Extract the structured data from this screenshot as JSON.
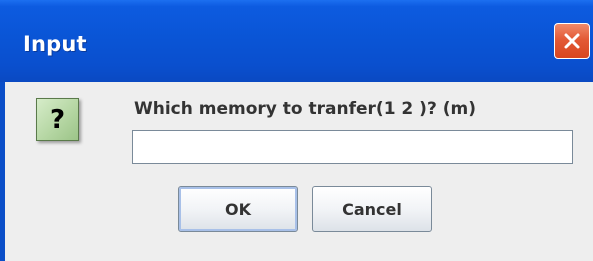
{
  "dialog": {
    "title": "Input",
    "close_glyph": "✕",
    "icon": "question-icon",
    "icon_glyph": "?",
    "prompt": "Which memory to tranfer(1 2 )? (m)",
    "input_value": "",
    "ok_label": "OK",
    "cancel_label": "Cancel"
  },
  "colors": {
    "titlebar": "#0a55d6",
    "close_button": "#e35a36",
    "panel": "#eeeeee",
    "icon_bg": "#b6d7a4"
  }
}
